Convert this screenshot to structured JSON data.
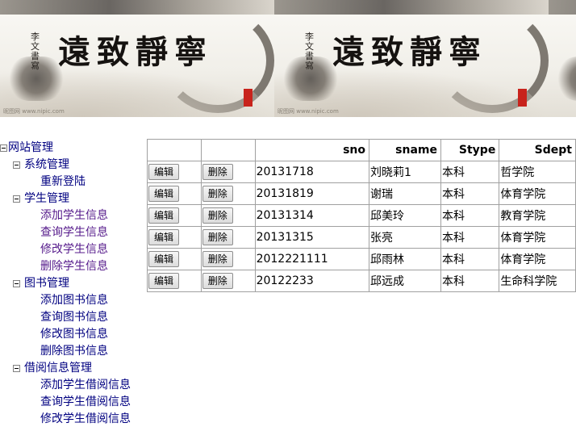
{
  "banner": {
    "calligraphy": "遠致靜寧",
    "small_text": "李文書寫",
    "watermark": "昵图网 www.nipic.com"
  },
  "tree": {
    "root": "网站管理",
    "groups": [
      {
        "label": "系统管理",
        "items": [
          "重新登陆"
        ]
      },
      {
        "label": "学生管理",
        "items": [
          "添加学生信息",
          "查询学生信息",
          "修改学生信息",
          "删除学生信息"
        ]
      },
      {
        "label": "图书管理",
        "items": [
          "添加图书信息",
          "查询图书信息",
          "修改图书信息",
          "删除图书信息"
        ]
      },
      {
        "label": "借阅信息管理",
        "items": [
          "添加学生借阅信息",
          "查询学生借阅信息",
          "修改学生借阅信息"
        ]
      }
    ]
  },
  "table": {
    "columns": [
      "sno",
      "sname",
      "Stype",
      "Sdept"
    ],
    "edit_label": "编辑",
    "delete_label": "删除",
    "rows": [
      {
        "sno": "20131718",
        "sname": "刘晓莉1",
        "stype": "本科",
        "sdept": "哲学院"
      },
      {
        "sno": "20131819",
        "sname": "谢瑞",
        "stype": "本科",
        "sdept": "体育学院"
      },
      {
        "sno": "20131314",
        "sname": "邱美玲",
        "stype": "本科",
        "sdept": "教育学院"
      },
      {
        "sno": "20131315",
        "sname": "张亮",
        "stype": "本科",
        "sdept": "体育学院"
      },
      {
        "sno": "2012221111",
        "sname": "邱雨林",
        "stype": "本科",
        "sdept": "体育学院"
      },
      {
        "sno": "20122233",
        "sname": "邱远成",
        "stype": "本科",
        "sdept": "生命科学院"
      }
    ]
  }
}
